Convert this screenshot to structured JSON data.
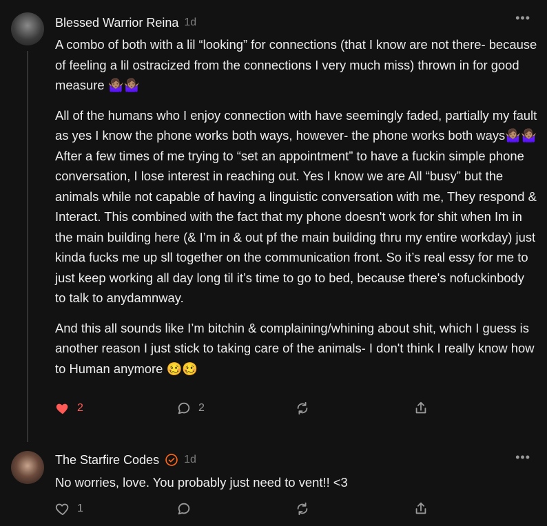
{
  "comments": [
    {
      "author": "Blessed Warrior Reina",
      "time": "1d",
      "paragraphs": [
        "A combo of both with a lil “looking” for connections (that I know are not there- because of feeling a lil ostracized from the connections I very much miss) thrown in for good measure 🤷🏽‍♀️🤷🏽‍♀️",
        "All of the humans who I enjoy connection with have seemingly faded, partially my fault as yes I know the phone works both ways, however- the phone works both ways🤷🏽‍♀️🤷🏽‍♀️ After a few times of me trying to “set an appointment” to have a fuckin simple phone conversation, I lose interest in reaching out. Yes I know we are All “busy” but the animals while not capable of having a linguistic conversation with me, They respond & Interact. This combined with the fact that my phone doesn't work for shit when Im in the main building here (& I’m in & out pf the main building thru my entire workday) just kinda fucks me up sll together on the communication front. So it’s real essy for me to just keep working all day long til it’s time to go to bed, because there's nofuckinbody to talk to anydamnway.",
        "And this all sounds like I’m bitchin & complaining/whining about shit, which I guess is another reason I just stick to taking care of the animals- I don't think I really know how to Human anymore 🥴🥴"
      ],
      "likes": "2",
      "replies": "2",
      "liked": true,
      "colors": {
        "like": "#ff5a55"
      }
    },
    {
      "author": "The Starfire Codes",
      "time": "1d",
      "text": "No worries, love. You probably just need to vent!! <3",
      "likes": "1",
      "verified": true,
      "colors": {
        "verified": "#ff6719"
      }
    }
  ],
  "ui": {
    "more_label": "•••"
  }
}
